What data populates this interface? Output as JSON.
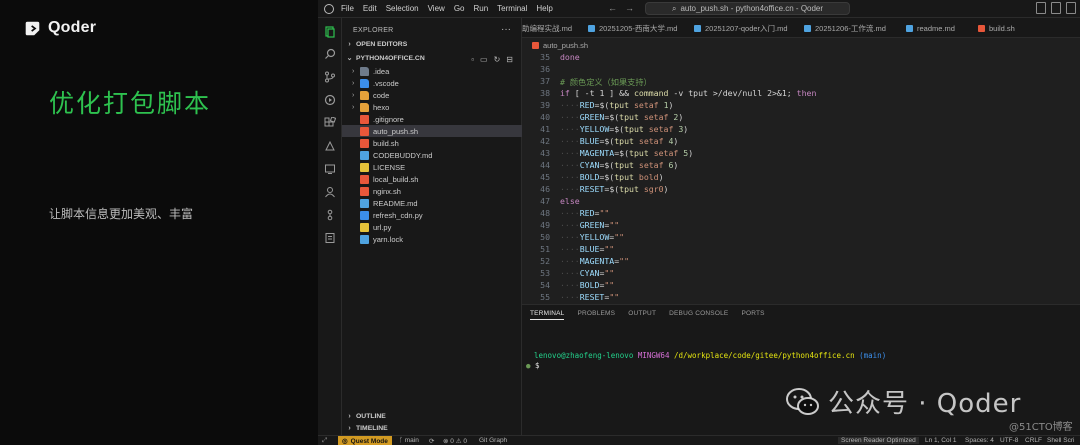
{
  "brand": {
    "name": "Qoder"
  },
  "slide": {
    "title": "优化打包脚本",
    "subtitle": "让脚本信息更加美观、丰富"
  },
  "titlebar": {
    "menus": [
      "File",
      "Edit",
      "Selection",
      "View",
      "Go",
      "Run",
      "Terminal",
      "Help"
    ],
    "search_text": "auto_push.sh - python4office.cn - Qoder"
  },
  "explorer": {
    "header": "EXPLORER",
    "open_editors": "OPEN EDITORS",
    "root": "PYTHON4OFFICE.CN",
    "items": [
      {
        "label": ".idea",
        "kind": "folder",
        "color": "#6e7b8b"
      },
      {
        "label": ".vscode",
        "kind": "folder",
        "color": "#3b8eea"
      },
      {
        "label": "code",
        "kind": "folder",
        "color": "#e5a13a"
      },
      {
        "label": "hexo",
        "kind": "folder",
        "color": "#e5a13a"
      },
      {
        "label": ".gitignore",
        "kind": "file",
        "color": "#e8573a"
      },
      {
        "label": "auto_push.sh",
        "kind": "file",
        "color": "#e8573a",
        "selected": true
      },
      {
        "label": "build.sh",
        "kind": "file",
        "color": "#e8573a"
      },
      {
        "label": "CODEBUDDY.md",
        "kind": "file",
        "color": "#4fa3e0"
      },
      {
        "label": "LICENSE",
        "kind": "file",
        "color": "#e5c33a"
      },
      {
        "label": "local_build.sh",
        "kind": "file",
        "color": "#e8573a"
      },
      {
        "label": "nginx.sh",
        "kind": "file",
        "color": "#e8573a"
      },
      {
        "label": "README.md",
        "kind": "file",
        "color": "#4fa3e0"
      },
      {
        "label": "refresh_cdn.py",
        "kind": "file",
        "color": "#3b8eea"
      },
      {
        "label": "url.py",
        "kind": "file",
        "color": "#e5c33a"
      },
      {
        "label": "yarn.lock",
        "kind": "file",
        "color": "#4fa3e0"
      }
    ],
    "outline": "OUTLINE",
    "timeline": "TIMELINE"
  },
  "tabs": [
    {
      "label": "助编程实战.md",
      "color": "#4fa3e0"
    },
    {
      "label": "20251205-西南大学.md",
      "color": "#4fa3e0"
    },
    {
      "label": "20251207-qoder入门.md",
      "color": "#4fa3e0"
    },
    {
      "label": "20251206-工作流.md",
      "color": "#4fa3e0"
    },
    {
      "label": "readme.md",
      "color": "#4fa3e0"
    },
    {
      "label": "build.sh",
      "color": "#e8573a"
    }
  ],
  "breadcrumb": "auto_push.sh",
  "editor": {
    "line_numbers": [
      "35",
      "36",
      "37",
      "38",
      "39",
      "40",
      "41",
      "42",
      "43",
      "44",
      "45",
      "46",
      "47",
      "48",
      "49",
      "50",
      "51",
      "52",
      "53",
      "54",
      "55"
    ]
  },
  "panel": {
    "tabs": [
      "TERMINAL",
      "PROBLEMS",
      "OUTPUT",
      "DEBUG CONSOLE",
      "PORTS"
    ],
    "prompt_user": "lenovo@zhaofeng-lenovo",
    "prompt_sys": "MINGW64",
    "prompt_path": "/d/workplace/code/gitee/python4office.cn",
    "prompt_branch": "(main)",
    "prompt_symbol": "$"
  },
  "statusbar": {
    "mode": "Quest Mode",
    "branch": "main",
    "problems": "0",
    "warnings": "0",
    "git_graph": "Git Graph",
    "screen_reader": "Screen Reader Optimized",
    "position": "Ln 1, Col 1",
    "spaces": "Spaces: 4",
    "encoding": "UTF-8",
    "eol": "CRLF",
    "language": "Shell Scri"
  },
  "watermark": {
    "main": "公众号 · Qoder",
    "secondary": "@51CTO博客"
  }
}
